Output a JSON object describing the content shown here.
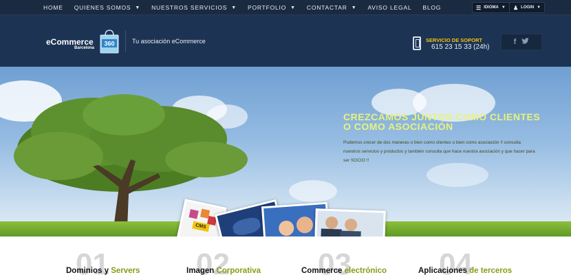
{
  "nav": {
    "items": [
      {
        "label": "HOME",
        "caret": false
      },
      {
        "label": "QUIENES SOMOS",
        "caret": true
      },
      {
        "label": "NUESTROS SERVICIOS",
        "caret": true
      },
      {
        "label": "PORTFOLIO",
        "caret": true
      },
      {
        "label": "CONTACTAR",
        "caret": true
      },
      {
        "label": "AVISO LEGAL",
        "caret": false
      },
      {
        "label": "BLOG",
        "caret": false
      }
    ],
    "idioma_label": "IDIOMA",
    "login_label": "LOGIN"
  },
  "header": {
    "logo_text": "eCommerce",
    "logo_sub": "Barcelona",
    "logo_badge": "360",
    "tagline": "Tu asociación eCommerce",
    "support_label": "SERVICIO DE SOPORT",
    "support_phone": "615 23 15 33 (24h)",
    "social": {
      "facebook": "f",
      "twitter": "t"
    }
  },
  "hero": {
    "title": "CREZCAMOS JUNTOS COMO CLIENTES O COMO ASOCIACIÓN",
    "text": "Podemos crecer de dos maneras o bien como clientes o bien como asociación !! consulta nuestros servicios y productos y también consulta que hace nuestra asociación y que hacer para ser SOCIO !!",
    "photo_cms_label": "CMS"
  },
  "features": [
    {
      "num": "01",
      "title_a": "Dominios y ",
      "title_b": "Servers"
    },
    {
      "num": "02",
      "title_a": "Imagen ",
      "title_b": "Corporativa"
    },
    {
      "num": "03",
      "title_a": "Commerce ",
      "title_b": "electrónico"
    },
    {
      "num": "04",
      "title_a": "Aplicaciones ",
      "title_b": "de terceros"
    }
  ],
  "colors": {
    "nav_bg": "#1a2a41",
    "header_bg": "#1c3353",
    "support_accent": "#f2c40c",
    "hero_title": "#e9f27a",
    "feature_highlight": "#8a9b19"
  }
}
